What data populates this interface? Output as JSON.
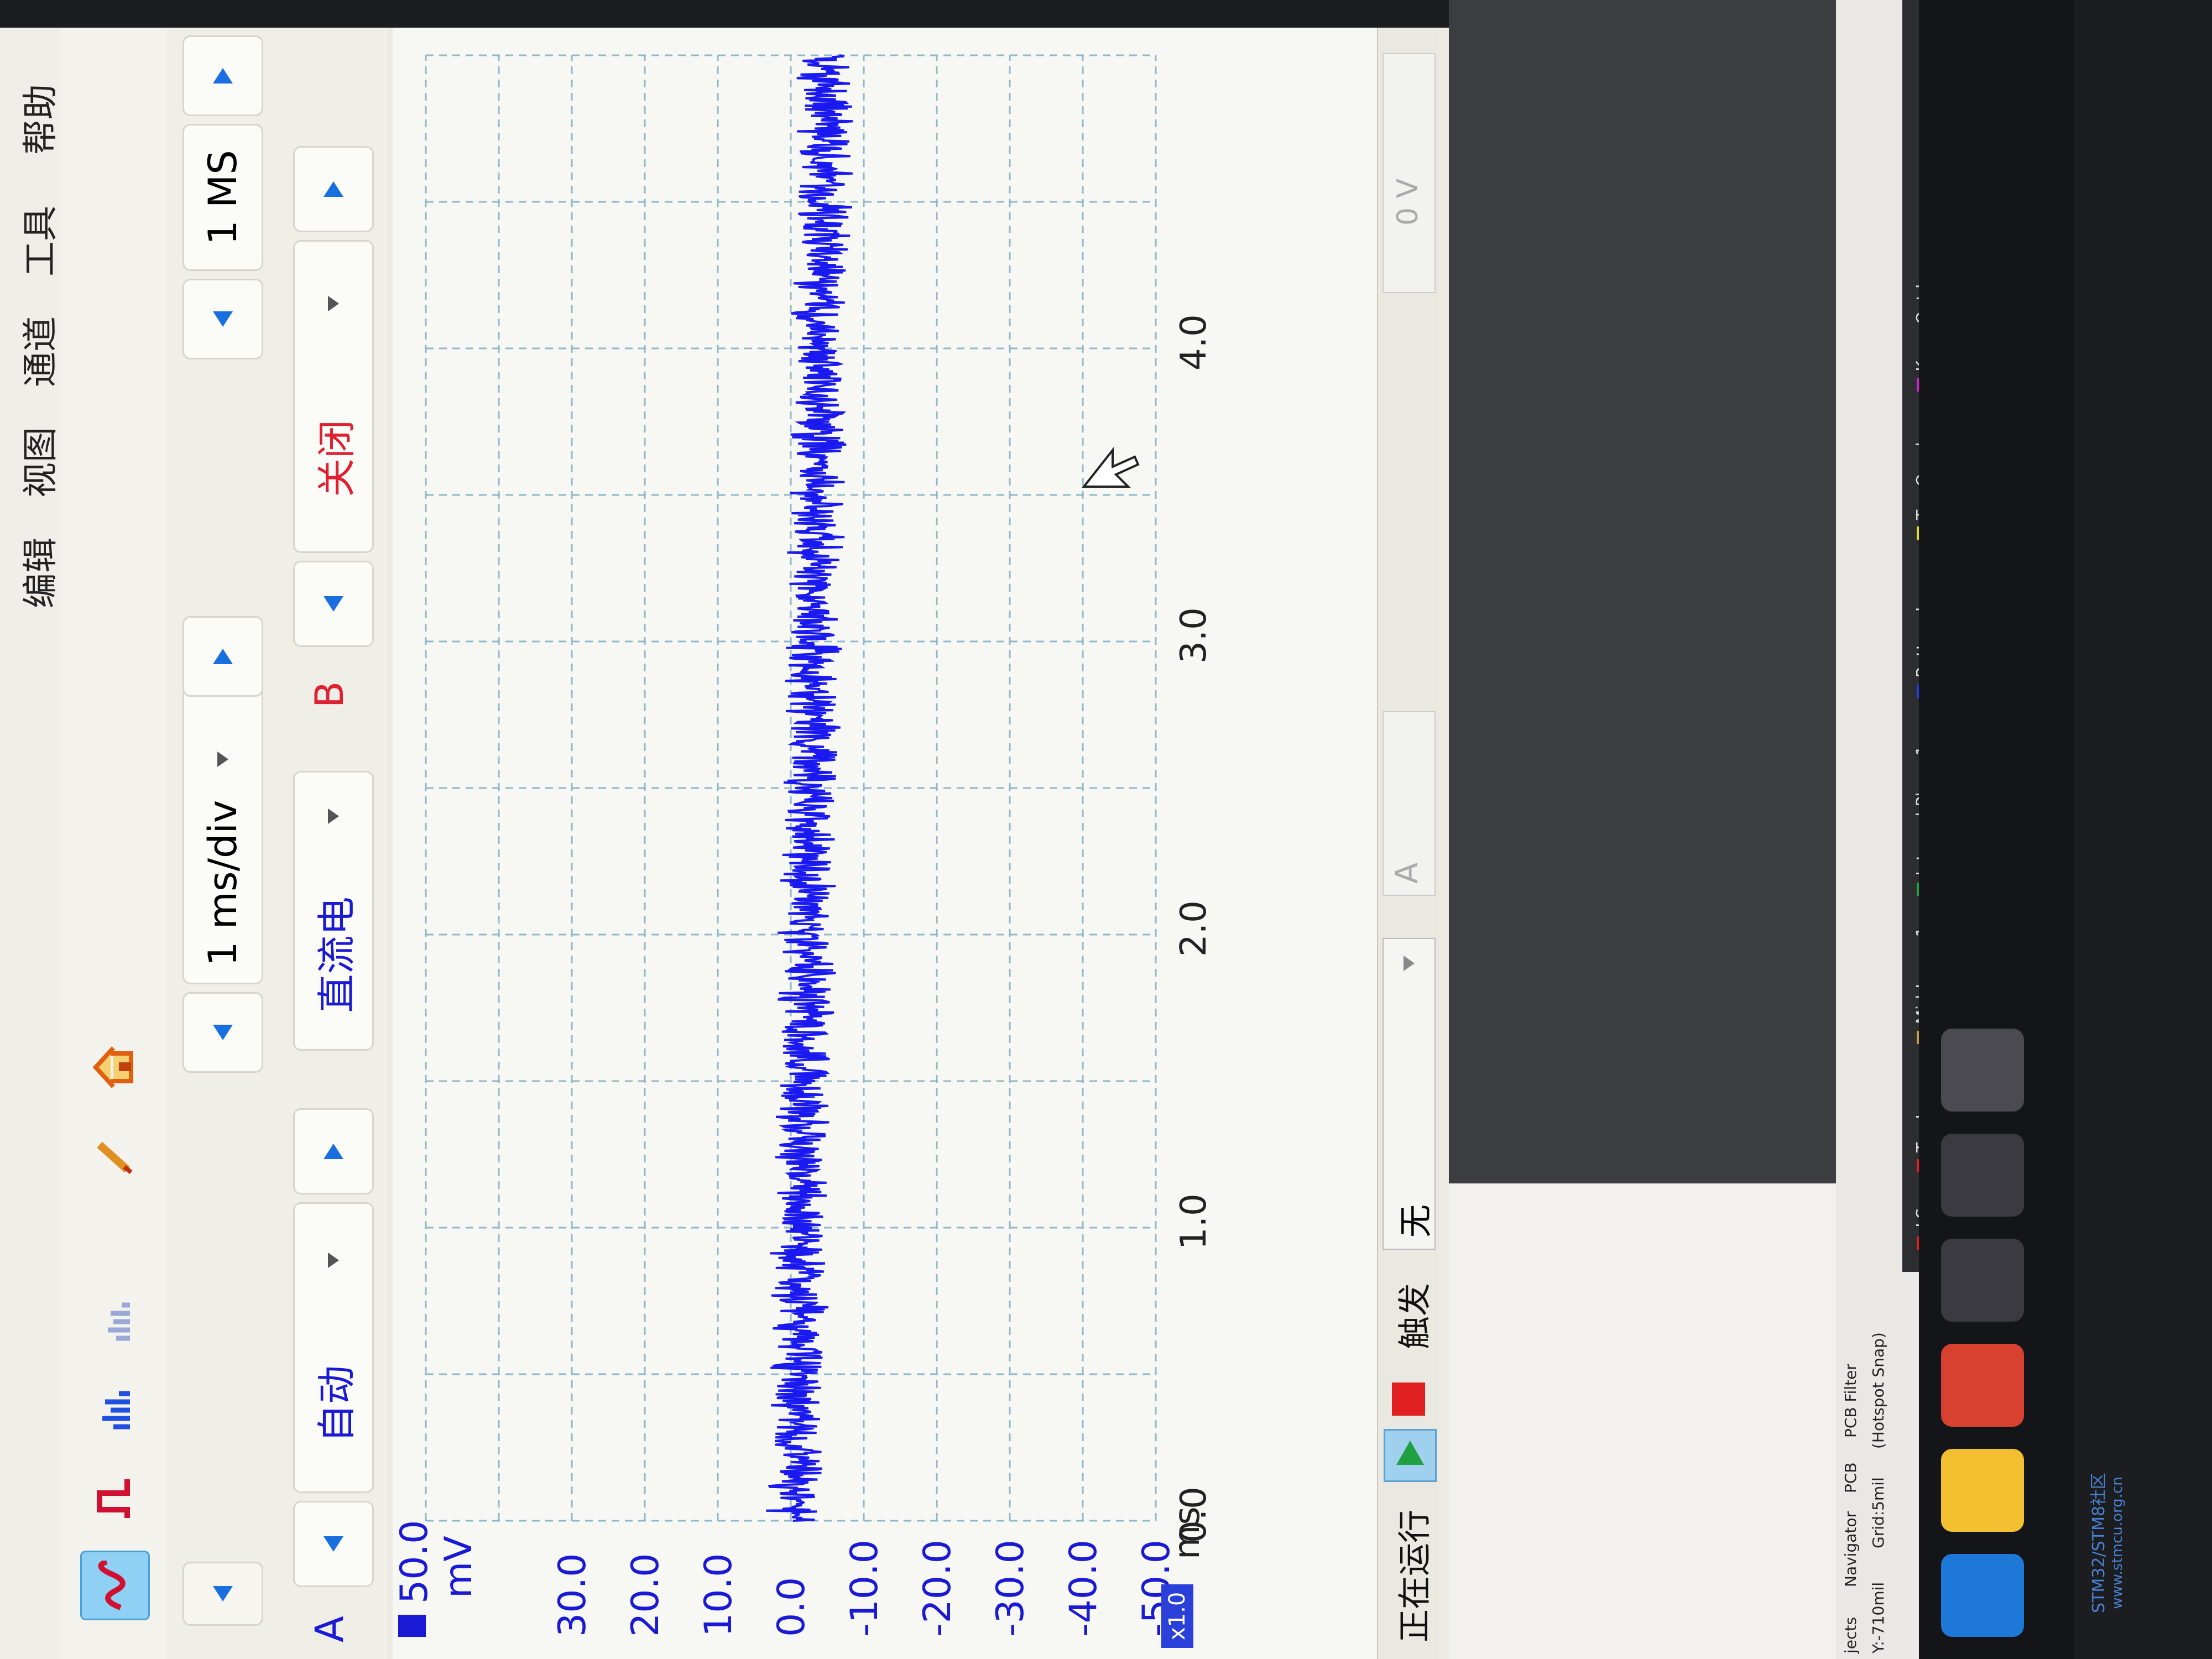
{
  "menu": {
    "items": [
      "编辑",
      "视图",
      "通道",
      "工具",
      "帮助"
    ]
  },
  "toolbar": {
    "icons": [
      "waveform-icon",
      "pulse-icon",
      "spectrum-icon",
      "spectrum-alt-icon",
      "pen-icon",
      "home-icon"
    ]
  },
  "channel_a": {
    "label": "A",
    "coupling": "自动",
    "range_mode": "直流电",
    "timebase": "1 ms/div",
    "samples": "1 MS"
  },
  "channel_b": {
    "label": "B",
    "state": "关闭"
  },
  "trace_color": "#1a1af0",
  "scope": {
    "y_unit": "mV",
    "y_ticks": [
      "50.0",
      "30.0",
      "20.0",
      "10.0",
      "0.0",
      "-10.0",
      "-20.0",
      "-30.0",
      "-40.0",
      "-50.0"
    ],
    "x_unit": "ms",
    "x_ticks": [
      "0.0",
      "1.0",
      "2.0",
      "3.0",
      "4.0"
    ],
    "zoom": "x1.0"
  },
  "status": {
    "running": "正在运行",
    "trigger_label": "触发",
    "trigger_mode": "无",
    "trigger_channel": "A",
    "level": "0 V"
  },
  "pcb": {
    "tabs": [
      "jects",
      "Navigator",
      "PCB",
      "PCB Filter"
    ],
    "coords": "Y:-710mil",
    "grid": "Grid:5mil",
    "snap": "(Hotspot Snap)",
    "ls": "LS",
    "layers": [
      {
        "name": "Top Layer",
        "color": "#e02020"
      },
      {
        "name": "Mid-Layer 1",
        "color": "#c8a040"
      },
      {
        "name": "Internal Plane 1",
        "color": "#20a040"
      },
      {
        "name": "Bottom Layer",
        "color": "#2040e0"
      },
      {
        "name": "Top Overlay",
        "color": "#e0e020"
      },
      {
        "name": "Keep-Out Layer",
        "color": "#d020d0"
      }
    ]
  },
  "watermark": {
    "line1": "STM32/STM8社区",
    "line2": "www.stmcu.org.cn"
  }
}
